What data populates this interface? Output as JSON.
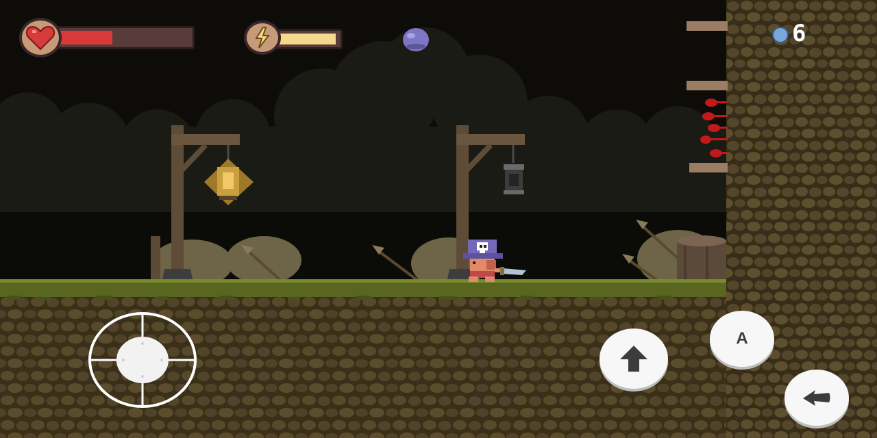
{
  "hud": {
    "health": {
      "icon": "heart-icon",
      "level": 0.4,
      "color": "#d63a3a"
    },
    "energy": {
      "icon": "lightning-icon",
      "level": 0.95,
      "color": "#f4d98b"
    },
    "orb": {
      "icon": "purple-orb-icon",
      "color": "#7d76c4"
    },
    "coin_counter": {
      "icon": "blue-coin-icon",
      "count": "6"
    }
  },
  "controls": {
    "joystick": {
      "icon": "virtual-joystick"
    },
    "jump": {
      "icon": "up-arrow-icon"
    },
    "attack": {
      "label": "A"
    },
    "dash": {
      "icon": "dash-arrow-icon"
    }
  },
  "colors": {
    "sky": "#0d0c09",
    "clouds": "#1a1a15",
    "grass": "#58661f",
    "dirt": "#4b3f22",
    "wall": "#4d4026",
    "blood": "#c21a1a",
    "pirate_hat": "#7468b8"
  }
}
